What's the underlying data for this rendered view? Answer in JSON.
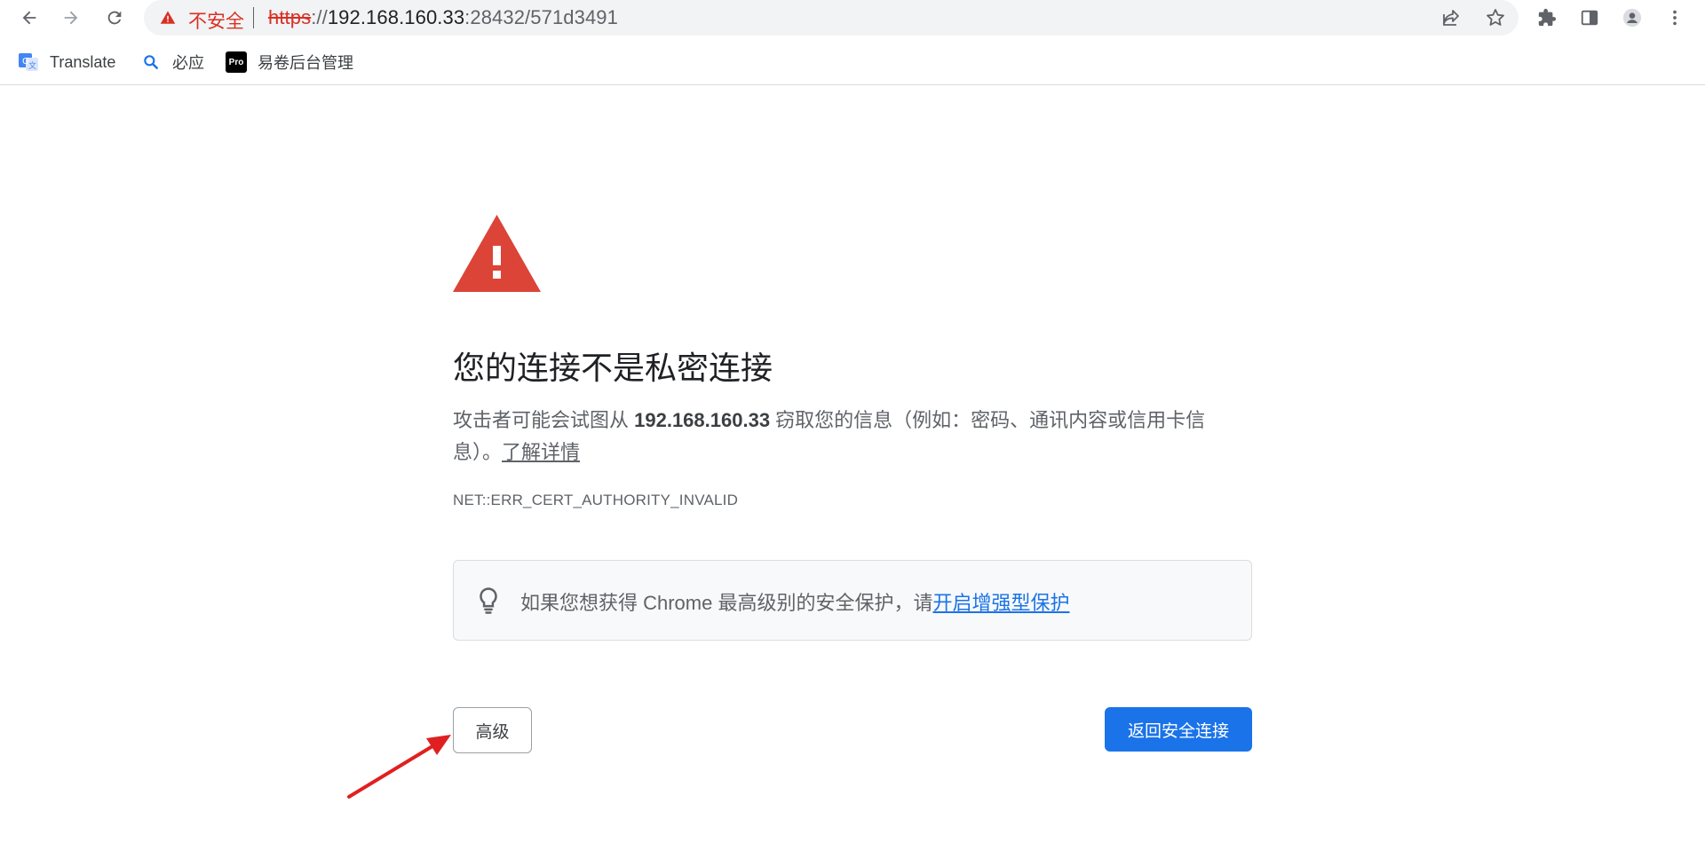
{
  "browser": {
    "security_label": "不安全",
    "url_scheme": "https",
    "url_sep": "://",
    "url_host": "192.168.160.33",
    "url_rest": ":28432/571d3491"
  },
  "bookmarks": [
    {
      "label": "Translate",
      "icon": "google-translate-icon"
    },
    {
      "label": "必应",
      "icon": "bing-search-icon"
    },
    {
      "label": "易卷后台管理",
      "icon": "pro-badge-icon",
      "badge": "Pro"
    }
  ],
  "page": {
    "heading": "您的连接不是私密连接",
    "explain_prefix": "攻击者可能会试图从 ",
    "explain_host": "192.168.160.33",
    "explain_suffix": " 窃取您的信息（例如：密码、通讯内容或信用卡信息）。",
    "learn_more": "了解详情",
    "error_code": "NET::ERR_CERT_AUTHORITY_INVALID",
    "tip_text": "如果您想获得 Chrome 最高级别的安全保护，请",
    "tip_link": "开启增强型保护",
    "advanced_button": "高级",
    "back_button": "返回安全连接"
  },
  "colors": {
    "warning_red": "#d93025",
    "primary_blue": "#1a73e8",
    "annotation_red": "#e02020"
  }
}
